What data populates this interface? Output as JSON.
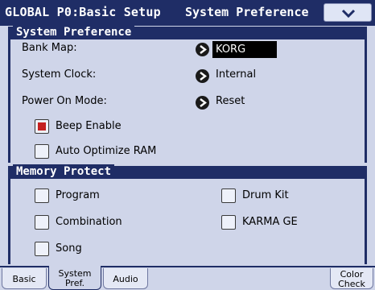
{
  "title_bar": {
    "mode": "GLOBAL P0:Basic Setup",
    "page": "System Preference",
    "menu_icon": "chevron-down-icon"
  },
  "system_preference": {
    "header": "System Preference",
    "bank_map": {
      "label": "Bank Map:",
      "value": "KORG"
    },
    "system_clock": {
      "label": "System Clock:",
      "value": "Internal"
    },
    "power_on_mode": {
      "label": "Power On Mode:",
      "value": "Reset"
    },
    "beep_enable": {
      "label": "Beep Enable",
      "checked": true
    },
    "auto_optimize_ram": {
      "label": "Auto Optimize RAM",
      "checked": false
    }
  },
  "memory_protect": {
    "header": "Memory Protect",
    "program": {
      "label": "Program",
      "checked": false
    },
    "combination": {
      "label": "Combination",
      "checked": false
    },
    "song": {
      "label": "Song",
      "checked": false
    },
    "drum_kit": {
      "label": "Drum Kit",
      "checked": false
    },
    "karma_ge": {
      "label": "KARMA GE",
      "checked": false
    }
  },
  "tabs": [
    {
      "line1": "Basic",
      "line2": "",
      "active": false
    },
    {
      "line1": "System",
      "line2": "Pref.",
      "active": true
    },
    {
      "line1": "Audio",
      "line2": "",
      "active": false
    },
    {
      "line1": "Color",
      "line2": "Check",
      "active": false
    }
  ],
  "colors": {
    "header_navy": "#1f2d66",
    "background": "#cfd5e9",
    "check_red": "#c42020"
  }
}
